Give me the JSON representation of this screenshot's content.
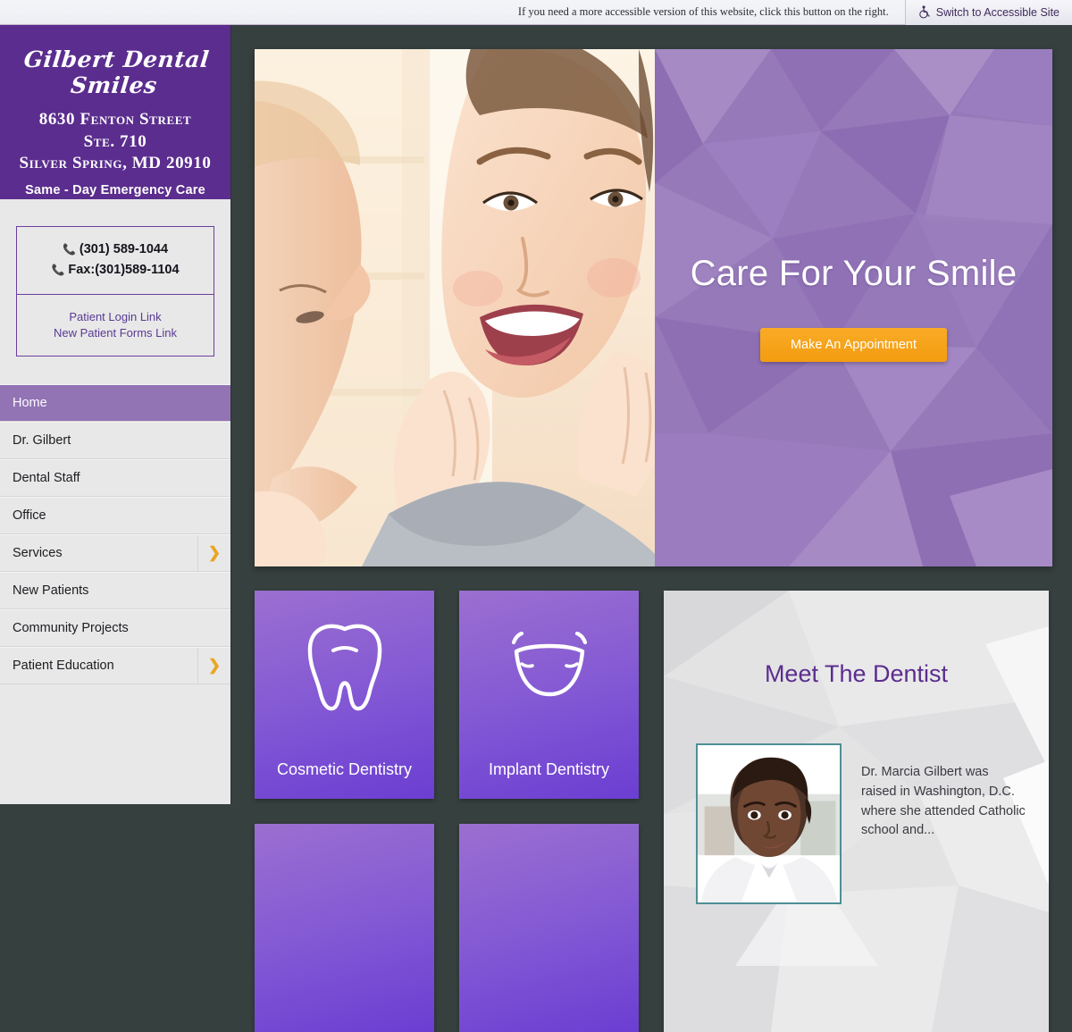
{
  "accessibility_bar": {
    "note": "If you need a more accessible version of this website, click this button on the right.",
    "button_label": "Switch to Accessible Site",
    "button_icon": "wheelchair-icon"
  },
  "sidebar": {
    "logo": {
      "practice_name": "Gilbert Dental Smiles",
      "address_line1": "8630 Fenton Street",
      "address_line2": "Ste. 710",
      "address_line3": "Silver Spring, MD 20910",
      "tagline": "Same - Day Emergency Care",
      "background": "#5b2d8e"
    },
    "contact": {
      "phone": "(301) 589-1044",
      "fax": "Fax:(301)589-1104",
      "phone_icon": "phone-icon",
      "links": [
        "Patient Login Link",
        "New Patient Forms Link"
      ]
    },
    "nav": [
      {
        "label": "Home",
        "active": true,
        "has_submenu": false
      },
      {
        "label": "Dr. Gilbert",
        "active": false,
        "has_submenu": false
      },
      {
        "label": "Dental Staff",
        "active": false,
        "has_submenu": false
      },
      {
        "label": "Office",
        "active": false,
        "has_submenu": false
      },
      {
        "label": "Services",
        "active": false,
        "has_submenu": true
      },
      {
        "label": "New Patients",
        "active": false,
        "has_submenu": false
      },
      {
        "label": "Community Projects",
        "active": false,
        "has_submenu": false
      },
      {
        "label": "Patient Education",
        "active": false,
        "has_submenu": true
      }
    ],
    "submenu_glyph": "❯",
    "active_color": "#9273b4"
  },
  "hero": {
    "image_alt": "Smiling woman looking at her reflection in a mirror",
    "title": "Care For Your Smile",
    "cta_label": "Make An Appointment",
    "cta_color": "#f39c10",
    "panel_color": "#9579b9"
  },
  "service_cards": [
    {
      "label": "Cosmetic Dentistry",
      "icon": "tooth-icon"
    },
    {
      "label": "Implant Dentistry",
      "icon": "smile-icon"
    },
    {
      "label": "",
      "icon": ""
    },
    {
      "label": "",
      "icon": ""
    }
  ],
  "dentist_panel": {
    "title": "Meet The Dentist",
    "photo_alt": "Portrait of Dr. Marcia Gilbert",
    "bio": "Dr. Marcia Gilbert was raised in Washington, D.C. where she attended Catholic school and...",
    "title_color": "#5b2d8e"
  },
  "theme": {
    "page_background": "#36403f",
    "sidebar_background": "#e8e8e8",
    "brand_purple": "#5b2d8e",
    "accent_orange": "#eaa521"
  }
}
